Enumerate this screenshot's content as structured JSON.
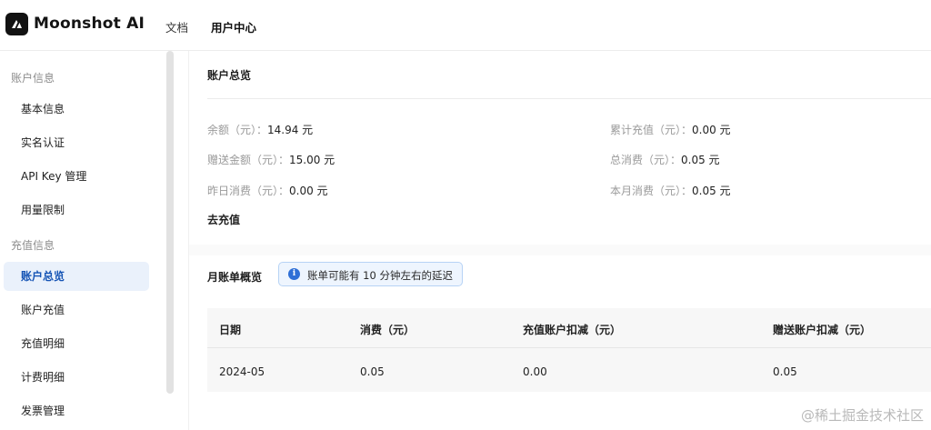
{
  "header": {
    "logo_text": "Moonshot AI",
    "nav": [
      {
        "label": "文档"
      },
      {
        "label": "用户中心"
      }
    ]
  },
  "sidebar": {
    "groups": [
      {
        "label": "账户信息",
        "items": [
          {
            "label": "基本信息"
          },
          {
            "label": "实名认证"
          },
          {
            "label": "API Key 管理"
          },
          {
            "label": "用量限制"
          }
        ]
      },
      {
        "label": "充值信息",
        "items": [
          {
            "label": "账户总览"
          },
          {
            "label": "账户充值"
          },
          {
            "label": "充值明细"
          },
          {
            "label": "计费明细"
          },
          {
            "label": "发票管理"
          }
        ]
      }
    ],
    "active": "账户总览"
  },
  "overview": {
    "title": "账户总览",
    "stats": [
      {
        "label": "余额（元）：",
        "value": "14.94 元"
      },
      {
        "label": "累计充值（元）：",
        "value": "0.00 元"
      },
      {
        "label": "赠送金额（元）：",
        "value": "15.00 元"
      },
      {
        "label": "总消费（元）：",
        "value": "0.05 元"
      },
      {
        "label": "昨日消费（元）：",
        "value": "0.00 元"
      },
      {
        "label": "本月消费（元）：",
        "value": "0.05 元"
      }
    ],
    "recharge_link": "去充值"
  },
  "monthly": {
    "title": "月账单概览",
    "notice": "账单可能有 10 分钟左右的延迟",
    "columns": [
      "日期",
      "消费（元）",
      "充值账户扣减（元）",
      "赠送账户扣减（元）"
    ],
    "rows": [
      [
        "2024-05",
        "0.05",
        "0.00",
        "0.05"
      ]
    ]
  },
  "watermark": "@稀土掘金技术社区",
  "colors": {
    "accent": "#1554b5",
    "active_bg": "#eaf1fb",
    "notice_bg": "#eef5fe",
    "notice_border": "#b7d3f5",
    "info_icon": "#2f6fd6"
  }
}
